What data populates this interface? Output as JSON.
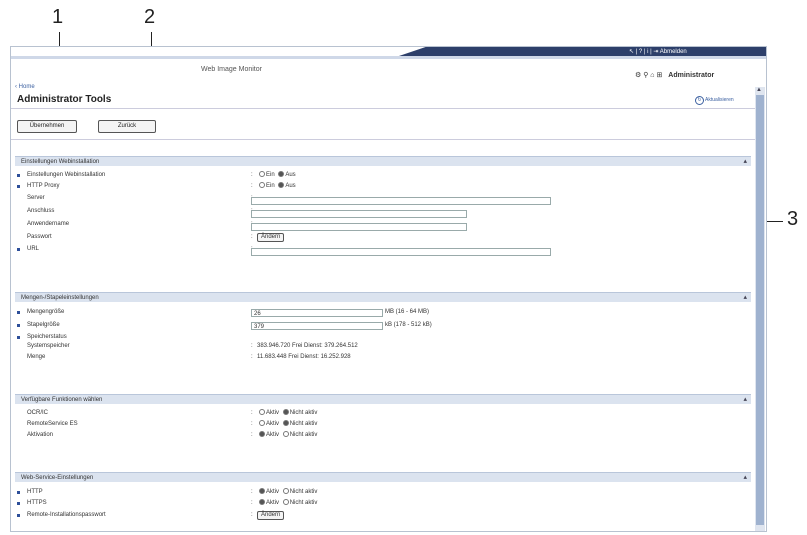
{
  "callouts": [
    "1",
    "2",
    "3"
  ],
  "header": {
    "title": "Web Image Monitor",
    "tool_icons": "↖ | ? | i | ⇥ Abmelden",
    "admin_icons": "⚙ ⚲ ⌂ ⊞",
    "admin_label": "Administrator"
  },
  "breadcrumb": "‹ Home",
  "page_title": "Administrator Tools",
  "help_label": "Aktualisieren",
  "buttons": {
    "apply": "Übernehmen",
    "back": "Zurück"
  },
  "sections": {
    "web": {
      "title": "Einstellungen Webinstallation",
      "rows": {
        "web_install": {
          "label": "Einstellungen Webinstallation",
          "opt1": "Ein",
          "opt2": "Aus"
        },
        "http_proxy": {
          "label": "HTTP Proxy",
          "opt1": "Ein",
          "opt2": "Aus"
        },
        "server": {
          "label": "Server"
        },
        "port": {
          "label": "Anschluss"
        },
        "username": {
          "label": "Anwendername"
        },
        "password": {
          "label": "Passwort",
          "button": "Ändern"
        },
        "url": {
          "label": "URL"
        }
      }
    },
    "volume": {
      "title": "Mengen-/Stapeleinstellungen",
      "rows": {
        "volume_size": {
          "label": "Mengengröße",
          "value": "26",
          "hint": "MB (16 - 64 MB)"
        },
        "stack_size": {
          "label": "Stapelgröße",
          "value": "379",
          "hint": "kB (178 - 512 kB)"
        },
        "memory_status": {
          "label": "Speicherstatus"
        },
        "system_memory": {
          "label": "Systemspeicher",
          "value": "383.946.720  Frei    Dienst: 379.264.512"
        },
        "amount": {
          "label": "Menge",
          "value": "11.683.448  Frei    Dienst: 16.252.928"
        }
      }
    },
    "functions": {
      "title": "Verfügbare Funktionen wählen",
      "rows": {
        "ocr": {
          "label": "OCR/IC",
          "opt1": "Aktiv",
          "opt2": "Nicht aktiv"
        },
        "remote": {
          "label": "RemoteService ES",
          "opt1": "Aktiv",
          "opt2": "Nicht aktiv"
        },
        "activation": {
          "label": "Aktivation",
          "opt1": "Aktiv",
          "opt2": "Nicht aktiv"
        }
      }
    },
    "webservice": {
      "title": "Web-Service-Einstellungen",
      "rows": {
        "http": {
          "label": "HTTP",
          "opt1": "Aktiv",
          "opt2": "Nicht aktiv"
        },
        "https": {
          "label": "HTTPS",
          "opt1": "Aktiv",
          "opt2": "Nicht aktiv"
        },
        "remote_pw": {
          "label": "Remote-Installationspasswort",
          "button": "Ändern"
        }
      }
    }
  }
}
